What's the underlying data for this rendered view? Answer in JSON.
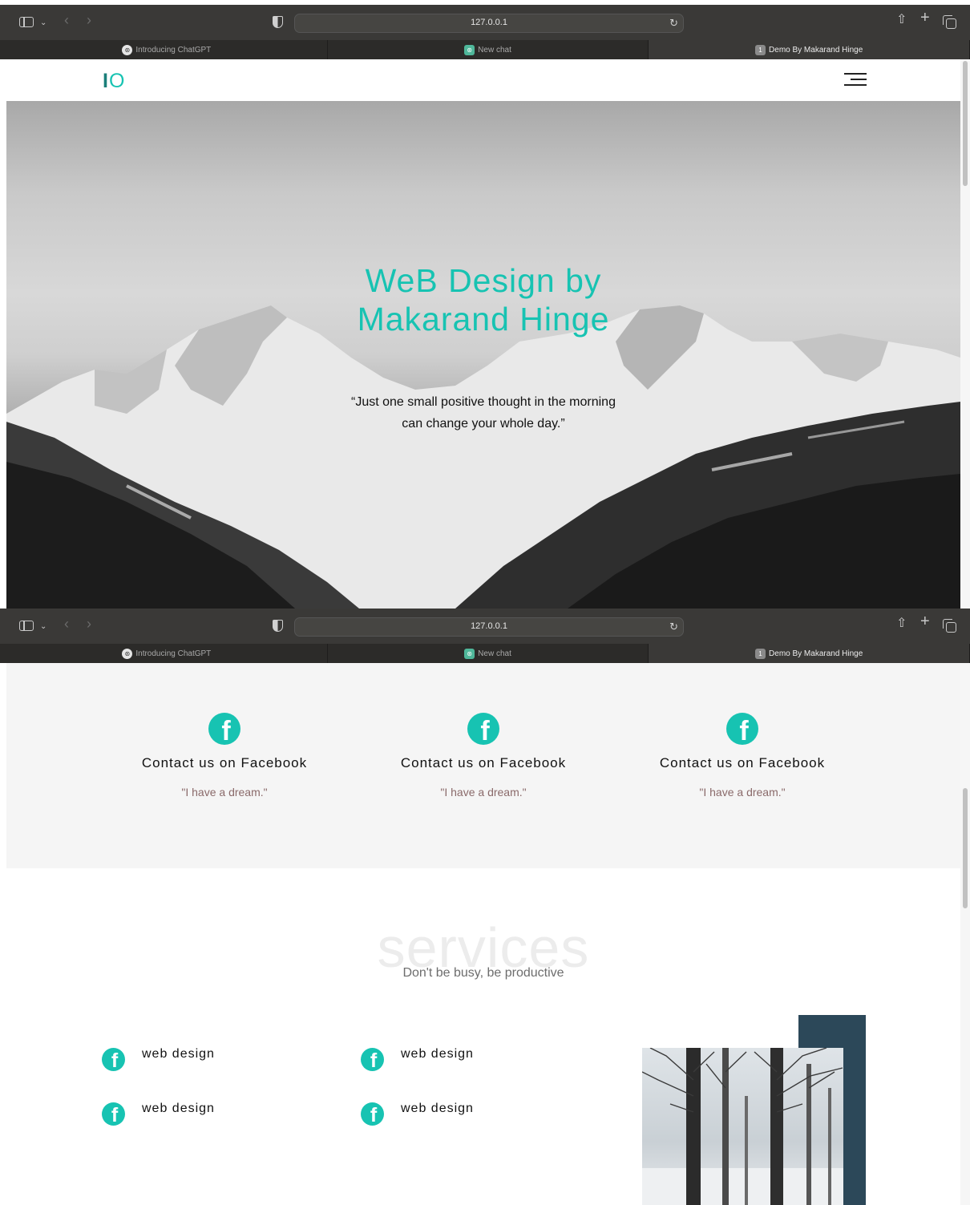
{
  "browser": {
    "url": "127.0.0.1",
    "tabs": [
      {
        "label": "Introducing ChatGPT",
        "active": false
      },
      {
        "label": "New chat",
        "active": false
      },
      {
        "label": "Demo By Makarand Hinge",
        "active": true,
        "badge": "1"
      }
    ]
  },
  "site": {
    "logo_i": "I",
    "logo_o": "O",
    "hero": {
      "title": "WeB Design by Makarand Hinge",
      "quote": "“Just one small positive thought in the morning can change your whole day.”"
    },
    "contacts": [
      {
        "title": "Contact us on Facebook",
        "subtitle": "\"I have a dream.\""
      },
      {
        "title": "Contact us on Facebook",
        "subtitle": "\"I have a dream.\""
      },
      {
        "title": "Contact us on Facebook",
        "subtitle": "\"I have a dream.\""
      }
    ],
    "services": {
      "heading": "services",
      "subheading": "Don't be busy, be productive",
      "items": [
        {
          "label": "web design"
        },
        {
          "label": "web design"
        },
        {
          "label": "web design"
        },
        {
          "label": "web design"
        }
      ]
    }
  },
  "colors": {
    "accent": "#17c3b2",
    "dark_block": "#2c4859",
    "chrome": "#3a3937"
  },
  "icons": {
    "social": "facebook-icon",
    "menu": "hamburger-menu-icon"
  }
}
